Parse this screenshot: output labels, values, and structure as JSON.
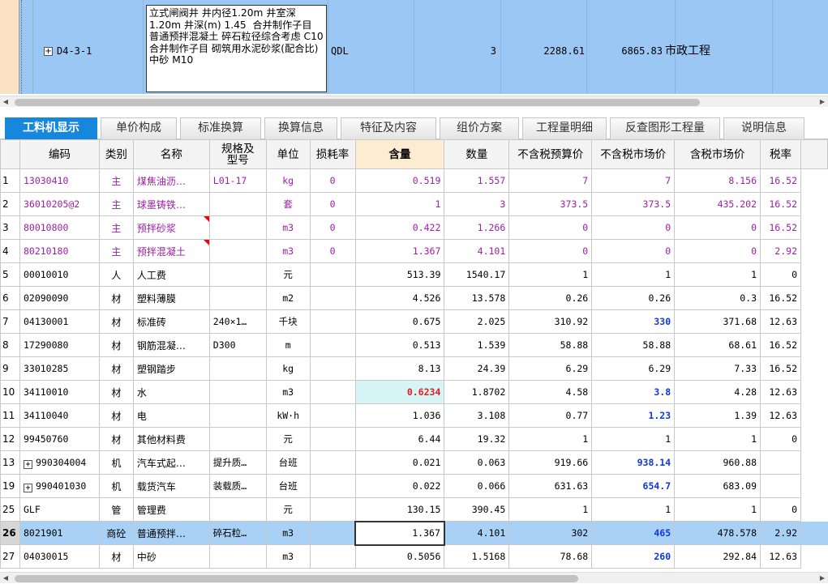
{
  "top_row": {
    "code": "D4-3-1",
    "description": "立式闸阀井 井内径1.20m 井室深1.20m 井深(m) 1.45  合并制作子目 普通预拌混凝土 碎石粒径综合考虑 C10  合并制作子目 砌筑用水泥砂浆(配合比) 中砂 M10",
    "unit": "QDL",
    "quantity": "3",
    "price": "2288.61",
    "total": "6865.83",
    "project_type": "市政工程"
  },
  "tabs": [
    {
      "label": "工料机显示",
      "active": true
    },
    {
      "label": "单价构成"
    },
    {
      "label": "标准换算"
    },
    {
      "label": "换算信息"
    },
    {
      "label": "特征及内容"
    },
    {
      "label": "组价方案"
    },
    {
      "label": "工程量明细"
    },
    {
      "label": "反查图形工程量"
    },
    {
      "label": "说明信息"
    }
  ],
  "columns": [
    "编码",
    "类别",
    "名称",
    "规格及型号",
    "单位",
    "损耗率",
    "含量",
    "数量",
    "不含税预算价",
    "不含税市场价",
    "含税市场价",
    "税率"
  ],
  "rows": [
    {
      "rn": "1",
      "code": "13030410",
      "type": "主",
      "name": "煤焦油沥…",
      "spec": "L01-17",
      "unit": "kg",
      "loss": "0",
      "content": "0.519",
      "qty": "1.557",
      "budget": "7",
      "market": "7",
      "market_tax": "8.156",
      "tax": "16.52"
    },
    {
      "rn": "2",
      "code": "36010205@2",
      "type": "主",
      "name": "球墨铸铁…",
      "spec": "",
      "unit": "套",
      "loss": "0",
      "content": "1",
      "qty": "3",
      "budget": "373.5",
      "market": "373.5",
      "market_tax": "435.202",
      "tax": "16.52"
    },
    {
      "rn": "3",
      "code": "80010800",
      "type": "主",
      "name": "预拌砂浆",
      "spec": "",
      "unit": "m3",
      "loss": "0",
      "content": "0.422",
      "qty": "1.266",
      "budget": "0",
      "market": "0",
      "market_tax": "0",
      "tax": "16.52"
    },
    {
      "rn": "4",
      "code": "80210180",
      "type": "主",
      "name": "预拌混凝土",
      "spec": "",
      "unit": "m3",
      "loss": "0",
      "content": "1.367",
      "qty": "4.101",
      "budget": "0",
      "market": "0",
      "market_tax": "0",
      "tax": "2.92"
    },
    {
      "rn": "5",
      "code": "00010010",
      "type": "人",
      "name": "人工费",
      "spec": "",
      "unit": "元",
      "loss": "",
      "content": "513.39",
      "qty": "1540.17",
      "budget": "1",
      "market": "1",
      "market_tax": "1",
      "tax": "0"
    },
    {
      "rn": "6",
      "code": "02090090",
      "type": "材",
      "name": "塑料薄膜",
      "spec": "",
      "unit": "m2",
      "loss": "",
      "content": "4.526",
      "qty": "13.578",
      "budget": "0.26",
      "market": "0.26",
      "market_tax": "0.3",
      "tax": "16.52"
    },
    {
      "rn": "7",
      "code": "04130001",
      "type": "材",
      "name": "标准砖",
      "spec": "240×1…",
      "unit": "千块",
      "loss": "",
      "content": "0.675",
      "qty": "2.025",
      "budget": "310.92",
      "market": "330",
      "market_tax": "371.68",
      "tax": "12.63"
    },
    {
      "rn": "8",
      "code": "17290080",
      "type": "材",
      "name": "钢筋混凝…",
      "spec": "D300",
      "unit": "m",
      "loss": "",
      "content": "0.513",
      "qty": "1.539",
      "budget": "58.88",
      "market": "58.88",
      "market_tax": "68.61",
      "tax": "16.52"
    },
    {
      "rn": "9",
      "code": "33010285",
      "type": "材",
      "name": "塑钢踏步",
      "spec": "",
      "unit": "kg",
      "loss": "",
      "content": "8.13",
      "qty": "24.39",
      "budget": "6.29",
      "market": "6.29",
      "market_tax": "7.33",
      "tax": "16.52"
    },
    {
      "rn": "10",
      "code": "34110010",
      "type": "材",
      "name": "水",
      "spec": "",
      "unit": "m3",
      "loss": "",
      "content": "0.6234",
      "qty": "1.8702",
      "budget": "4.58",
      "market": "3.8",
      "market_tax": "4.28",
      "tax": "12.63"
    },
    {
      "rn": "11",
      "code": "34110040",
      "type": "材",
      "name": "电",
      "spec": "",
      "unit": "kW·h",
      "loss": "",
      "content": "1.036",
      "qty": "3.108",
      "budget": "0.77",
      "market": "1.23",
      "market_tax": "1.39",
      "tax": "12.63"
    },
    {
      "rn": "12",
      "code": "99450760",
      "type": "材",
      "name": "其他材料费",
      "spec": "",
      "unit": "元",
      "loss": "",
      "content": "6.44",
      "qty": "19.32",
      "budget": "1",
      "market": "1",
      "market_tax": "1",
      "tax": "0"
    },
    {
      "rn": "13",
      "code": "990304004",
      "type": "机",
      "name": "汽车式起…",
      "spec": "提升质…",
      "unit": "台班",
      "loss": "",
      "content": "0.021",
      "qty": "0.063",
      "budget": "919.66",
      "market": "938.14",
      "market_tax": "960.88",
      "tax": ""
    },
    {
      "rn": "19",
      "code": "990401030",
      "type": "机",
      "name": "载货汽车",
      "spec": "装载质…",
      "unit": "台班",
      "loss": "",
      "content": "0.022",
      "qty": "0.066",
      "budget": "631.63",
      "market": "654.7",
      "market_tax": "683.09",
      "tax": ""
    },
    {
      "rn": "25",
      "code": "GLF",
      "type": "管",
      "name": "管理费",
      "spec": "",
      "unit": "元",
      "loss": "",
      "content": "130.15",
      "qty": "390.45",
      "budget": "1",
      "market": "1",
      "market_tax": "1",
      "tax": "0"
    },
    {
      "rn": "26",
      "code": "8021901",
      "type": "商砼",
      "name": "普通预拌…",
      "spec": "碎石粒…",
      "unit": "m3",
      "loss": "",
      "content": "1.367",
      "qty": "4.101",
      "budget": "302",
      "market": "465",
      "market_tax": "478.578",
      "tax": "2.92"
    },
    {
      "rn": "27",
      "code": "04030015",
      "type": "材",
      "name": "中砂",
      "spec": "",
      "unit": "m3",
      "loss": "",
      "content": "0.5056",
      "qty": "1.5168",
      "budget": "78.68",
      "market": "260",
      "market_tax": "292.84",
      "tax": "12.63"
    }
  ],
  "colors": {
    "selection": "#9ac7f3",
    "active_tab": "#1787db",
    "main_material": "#9b1fa5",
    "changed_price": "#1038d8",
    "edited_value": "#e31c1c"
  }
}
